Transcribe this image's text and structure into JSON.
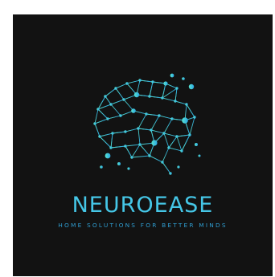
{
  "logo": {
    "brand_name": "NEUROEASE",
    "tagline": "HOME SOLUTIONS FOR BETTER MINDS",
    "background_color": "#121212",
    "accent_colors": [
      "#4fe0d2",
      "#39b7e8",
      "#2f9ccf"
    ],
    "emblem": "network-brain-icon"
  }
}
